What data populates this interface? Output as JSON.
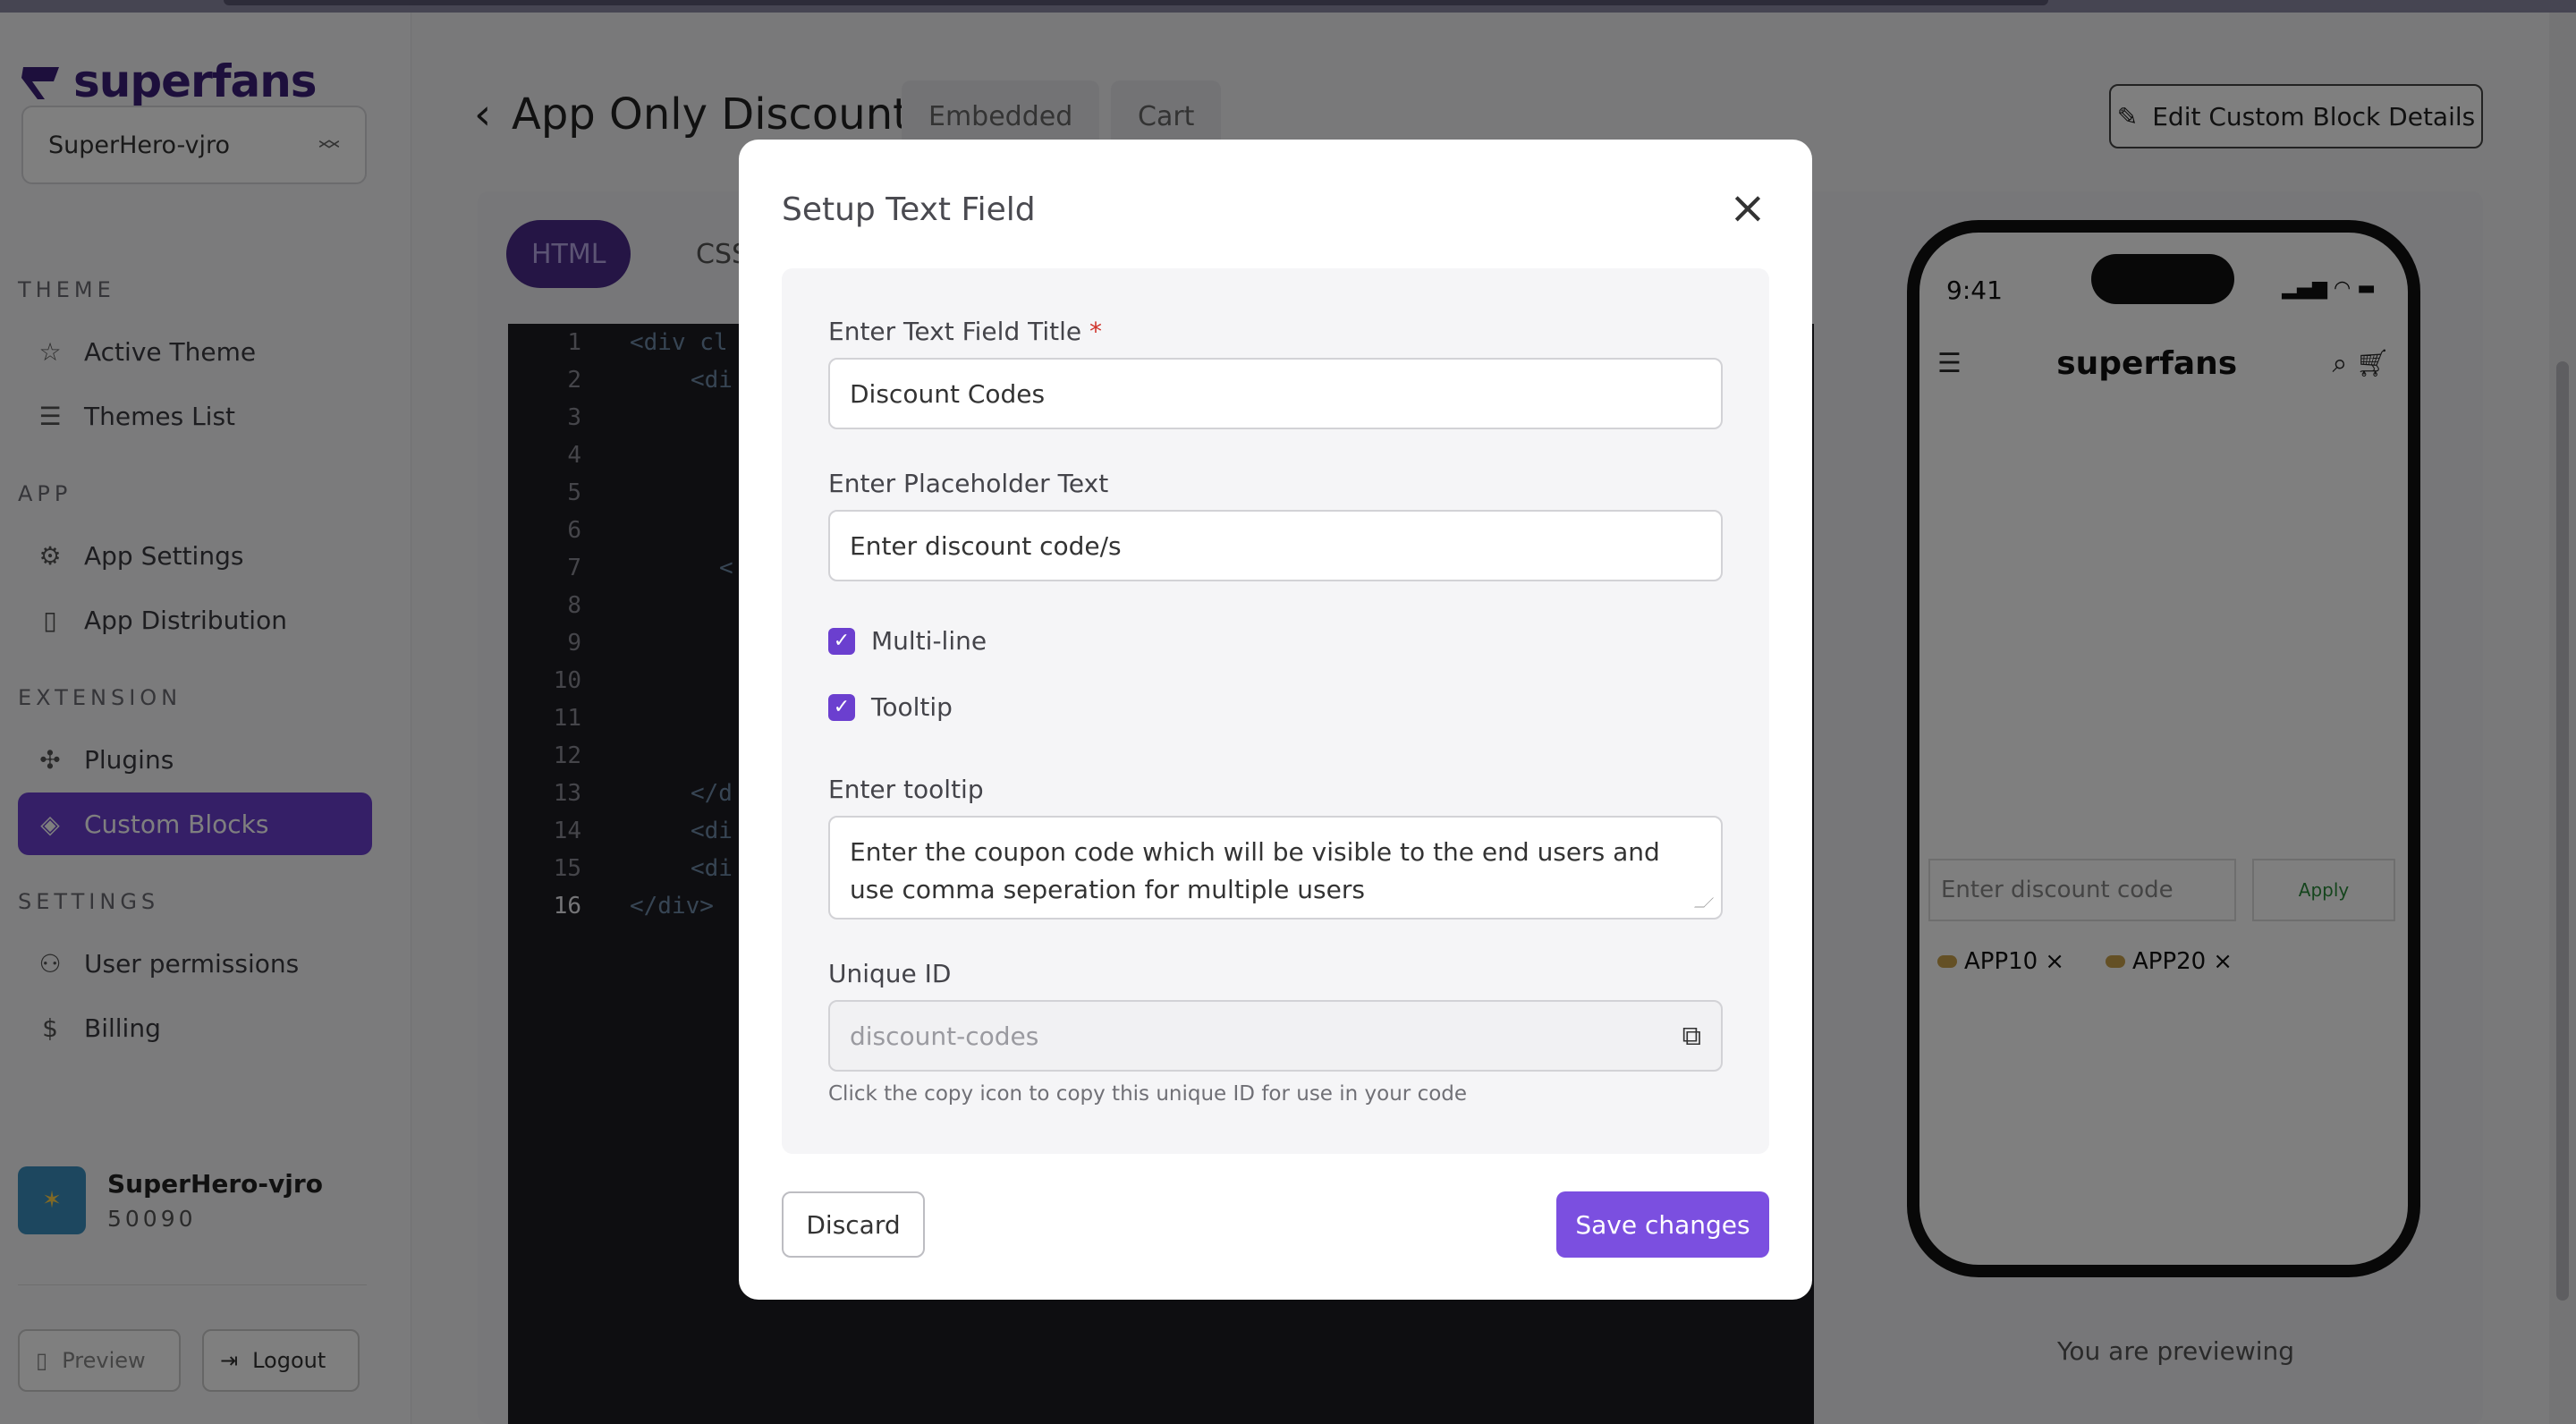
{
  "sidebar": {
    "brand": "superfans",
    "store_select": "SuperHero-vjro",
    "sections": {
      "theme": "THEME",
      "app": "APP",
      "extension": "EXTENSION",
      "settings": "SETTINGS"
    },
    "items": [
      {
        "label": "Active Theme",
        "icon": "theme-star-icon"
      },
      {
        "label": "Themes List",
        "icon": "list-icon"
      },
      {
        "label": "App Settings",
        "icon": "gear-icon"
      },
      {
        "label": "App Distribution",
        "icon": "phone-icon"
      },
      {
        "label": "Plugins",
        "icon": "puzzle-icon"
      },
      {
        "label": "Custom Blocks",
        "icon": "blocks-icon"
      },
      {
        "label": "User permissions",
        "icon": "user-plus-icon"
      },
      {
        "label": "Billing",
        "icon": "dollar-icon"
      }
    ],
    "user": {
      "name": "SuperHero-vjro",
      "id": "50090"
    },
    "preview_label": "Preview",
    "logout_label": "Logout"
  },
  "main": {
    "title": "App Only Discount",
    "tabs": [
      "Embedded",
      "Cart"
    ],
    "edit_button": "Edit Custom Block Details",
    "code_tabs": [
      "HTML",
      "CSS"
    ],
    "line_numbers": [
      "1",
      "2",
      "3",
      "4",
      "5",
      "6",
      "7",
      "8",
      "9",
      "10",
      "11",
      "12",
      "13",
      "14",
      "15",
      "16"
    ],
    "code_lines": [
      "<div cl",
      "<di",
      "<",
      "</d",
      "<di",
      "<di",
      "</div>"
    ],
    "previewing_text": "You are previewing"
  },
  "phone": {
    "time": "9:41",
    "brand": "superfans",
    "discount_placeholder": "Enter discount code",
    "apply_label": "Apply",
    "chips": [
      "APP10",
      "APP20"
    ],
    "chip_close": "×"
  },
  "modal": {
    "title": "Setup Text Field",
    "title_label": "Enter Text Field Title",
    "required_mark": "*",
    "title_value": "Discount Codes",
    "placeholder_label": "Enter Placeholder Text",
    "placeholder_value": "Enter discount code/s",
    "multiline_label": "Multi-line",
    "multiline_checked": true,
    "tooltip_label": "Tooltip",
    "tooltip_checked": true,
    "tooltip_field_label": "Enter tooltip",
    "tooltip_value": "Enter the coupon code which will be visible to the end users and use comma seperation for multiple users",
    "unique_id_label": "Unique ID",
    "unique_id_value": "discount-codes",
    "hint": "Click the copy icon to copy this unique ID for use in your code",
    "discard_label": "Discard",
    "save_label": "Save changes"
  },
  "colors": {
    "accent": "#6b3fcf",
    "save": "#7b4fe0",
    "brand": "#3a1e79"
  }
}
